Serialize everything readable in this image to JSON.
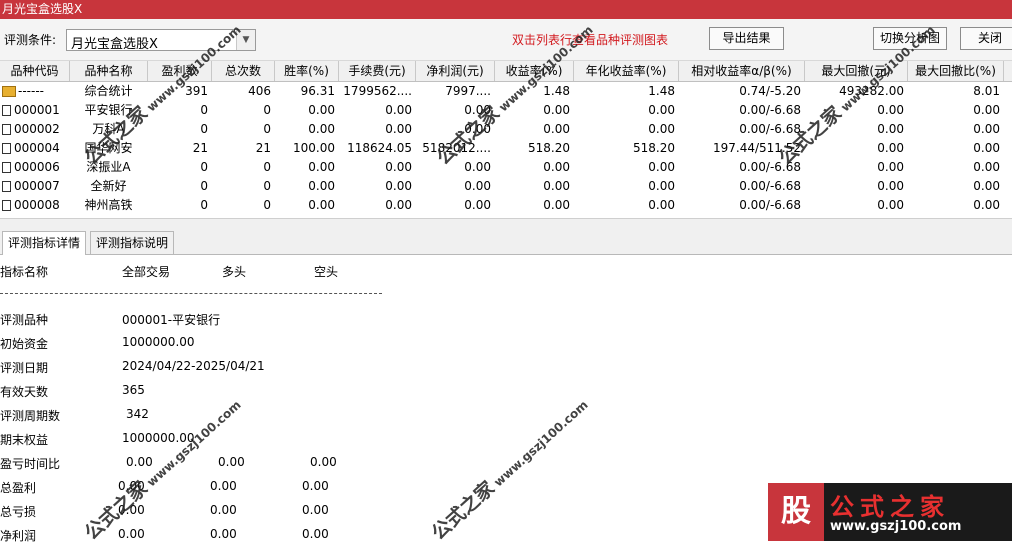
{
  "window": {
    "title": "月光宝盒选股X"
  },
  "toolbar": {
    "condition_label": "评测条件:",
    "condition_value": "月光宝盒选股X",
    "hint": "双击列表行查看品种评测图表",
    "export_label": "导出结果",
    "switch_label": "切换分析图",
    "close_label": "关闭"
  },
  "table": {
    "headers": [
      "品种代码",
      "品种名称",
      "盈利数",
      "总次数",
      "胜率(%)",
      "手续费(元)",
      "净利润(元)",
      "收益率(%)",
      "年化收益率(%)",
      "相对收益率α/β(%)",
      "最大回撤(元)",
      "最大回撤比(%)"
    ],
    "rows": [
      {
        "icon": "folder",
        "code": "------",
        "name": "综合统计",
        "profit_count": "391",
        "total_count": "406",
        "win_rate": "96.31",
        "fee": "1799562....",
        "net_profit": "7997....",
        "return_rate": "1.48",
        "annual_return": "1.48",
        "relative_return": "0.74/-5.20",
        "max_drawdown": "493282.00",
        "max_drawdown_ratio": "8.01"
      },
      {
        "icon": "doc",
        "code": "000001",
        "name": "平安银行",
        "profit_count": "0",
        "total_count": "0",
        "win_rate": "0.00",
        "fee": "0.00",
        "net_profit": "0.00",
        "return_rate": "0.00",
        "annual_return": "0.00",
        "relative_return": "0.00/-6.68",
        "max_drawdown": "0.00",
        "max_drawdown_ratio": "0.00"
      },
      {
        "icon": "doc",
        "code": "000002",
        "name": "万科A",
        "profit_count": "0",
        "total_count": "0",
        "win_rate": "0.00",
        "fee": "0.00",
        "net_profit": "0.00",
        "return_rate": "0.00",
        "annual_return": "0.00",
        "relative_return": "0.00/-6.68",
        "max_drawdown": "0.00",
        "max_drawdown_ratio": "0.00"
      },
      {
        "icon": "doc",
        "code": "000004",
        "name": "国华网安",
        "profit_count": "21",
        "total_count": "21",
        "win_rate": "100.00",
        "fee": "118624.05",
        "net_profit": "5182012....",
        "return_rate": "518.20",
        "annual_return": "518.20",
        "relative_return": "197.44/511.52",
        "max_drawdown": "0.00",
        "max_drawdown_ratio": "0.00"
      },
      {
        "icon": "doc",
        "code": "000006",
        "name": "深振业A",
        "profit_count": "0",
        "total_count": "0",
        "win_rate": "0.00",
        "fee": "0.00",
        "net_profit": "0.00",
        "return_rate": "0.00",
        "annual_return": "0.00",
        "relative_return": "0.00/-6.68",
        "max_drawdown": "0.00",
        "max_drawdown_ratio": "0.00"
      },
      {
        "icon": "doc",
        "code": "000007",
        "name": "全新好",
        "profit_count": "0",
        "total_count": "0",
        "win_rate": "0.00",
        "fee": "0.00",
        "net_profit": "0.00",
        "return_rate": "0.00",
        "annual_return": "0.00",
        "relative_return": "0.00/-6.68",
        "max_drawdown": "0.00",
        "max_drawdown_ratio": "0.00"
      },
      {
        "icon": "doc",
        "code": "000008",
        "name": "神州高铁",
        "profit_count": "0",
        "total_count": "0",
        "win_rate": "0.00",
        "fee": "0.00",
        "net_profit": "0.00",
        "return_rate": "0.00",
        "annual_return": "0.00",
        "relative_return": "0.00/-6.68",
        "max_drawdown": "0.00",
        "max_drawdown_ratio": "0.00"
      }
    ]
  },
  "tabs": [
    "评测指标详情",
    "评测指标说明"
  ],
  "detail": {
    "col_headers": [
      "指标名称",
      "全部交易",
      "多头",
      "空头"
    ],
    "separator": "------------------------------------------------------------",
    "items": [
      {
        "label": "评测品种",
        "value": "000001-平安银行"
      },
      {
        "label": "初始资金",
        "value": "1000000.00"
      },
      {
        "label": "评测日期",
        "value": "2024/04/22-2025/04/21"
      },
      {
        "label": "有效天数",
        "value": "365"
      },
      {
        "label": "评测周期数",
        "value": "342"
      },
      {
        "label": "期末权益",
        "value": "1000000.00"
      }
    ],
    "triples": [
      {
        "label": "盈亏时间比",
        "all": "0.00",
        "long": "0.00",
        "short": "0.00"
      },
      {
        "label": "总盈利",
        "all": "0.00",
        "long": "0.00",
        "short": "0.00"
      },
      {
        "label": "总亏损",
        "all": "0.00",
        "long": "0.00",
        "short": "0.00"
      },
      {
        "label": "净利润",
        "all": "0.00",
        "long": "0.00",
        "short": "0.00"
      }
    ]
  },
  "watermark": {
    "text": "公式之家",
    "url": "www.gszj100.com"
  },
  "logo": {
    "mark": "股",
    "title": "公式之家",
    "url": "www.gszj100.com"
  }
}
